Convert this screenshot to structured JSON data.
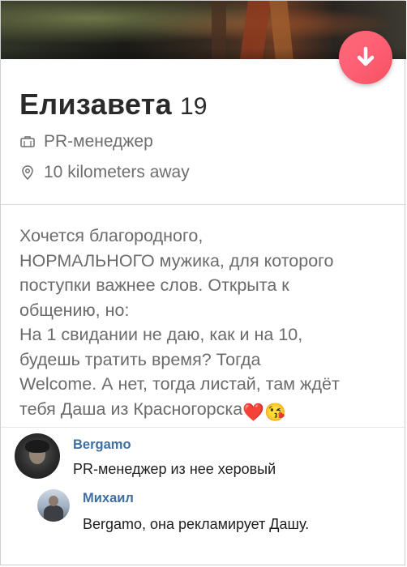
{
  "profile": {
    "name": "Елизавета",
    "age": "19",
    "job": "PR-менеджер",
    "distance": "10 kilometers away",
    "bio": "Хочется благородного,\nНОРМАЛЬНОГО мужика, для которого\nпоступки важнее слов. Открыта к\nобщению, но:\nНа 1 свидании не даю, как и на 10,\nбудешь тратить время? Тогда\nWelcome. А нет, тогда листай, там ждёт\nтебя Даша из Красногорска",
    "bio_emoji": "❤️😘",
    "icons": {
      "job": "briefcase-icon",
      "distance": "location-pin-icon",
      "fab": "arrow-down-icon"
    },
    "accent_color": "#fd5f74"
  },
  "comments": [
    {
      "author": "Bergamo",
      "text": "PR-менеджер из нее херовый"
    },
    {
      "author": "Михаил",
      "text": "Bergamo, она рекламирует Дашу."
    }
  ],
  "colors": {
    "link": "#3f6ea0",
    "secondary_text": "#6e6e6e"
  }
}
